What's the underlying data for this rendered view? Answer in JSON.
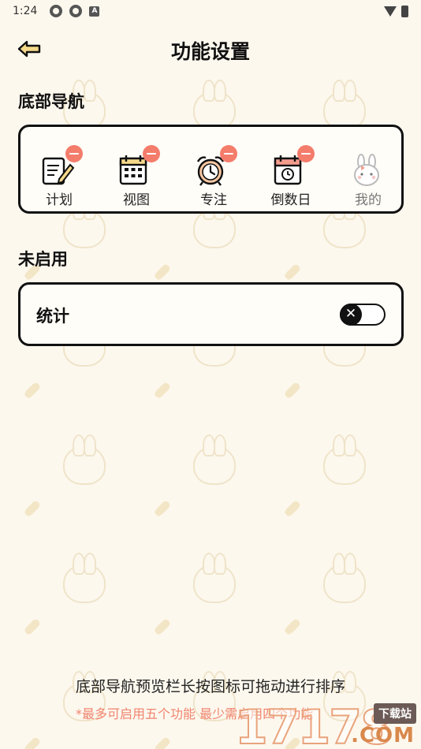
{
  "status_bar": {
    "time": "1:24",
    "notification_glyph": "A"
  },
  "header": {
    "title": "功能设置",
    "back_icon": "back-arrow-icon"
  },
  "bottom_nav_section": {
    "title": "底部导航",
    "items": [
      {
        "label": "计划",
        "icon": "plan-notepad-icon",
        "removable": true
      },
      {
        "label": "视图",
        "icon": "calendar-view-icon",
        "removable": true
      },
      {
        "label": "专注",
        "icon": "alarm-clock-icon",
        "removable": true
      },
      {
        "label": "倒数日",
        "icon": "countdown-calendar-icon",
        "removable": true
      },
      {
        "label": "我的",
        "icon": "bunny-profile-icon",
        "removable": false
      }
    ]
  },
  "disabled_section": {
    "title": "未启用",
    "items": [
      {
        "label": "统计",
        "toggle_state": "off",
        "toggle_glyph": "✕"
      }
    ]
  },
  "footer": {
    "hint": "底部导航预览栏长按图标可拖动进行排序",
    "note": "*最多可启用五个功能   最少需启用四个功能"
  },
  "watermark": {
    "digits": "17178",
    "badge": "下载站",
    "domain": ".COM"
  },
  "colors": {
    "background": "#fdf8ee",
    "accent_red": "#f47c6b",
    "border": "#111111",
    "note_color": "#f0846f"
  }
}
